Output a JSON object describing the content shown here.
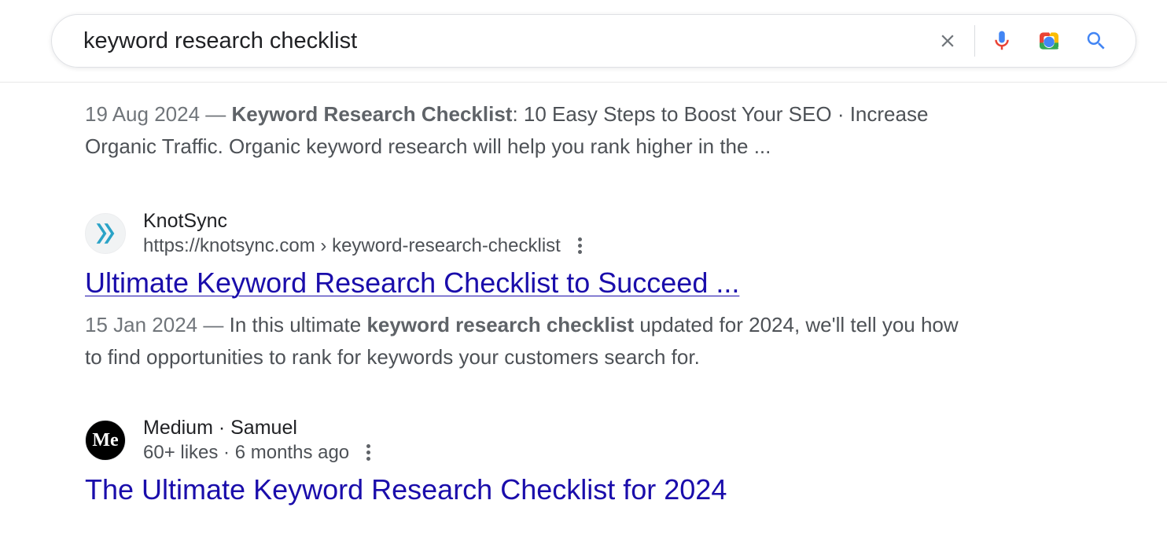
{
  "search": {
    "query": "keyword research checklist"
  },
  "partial_result": {
    "date": "19 Aug 2024",
    "bold": "Keyword Research Checklist",
    "rest": ": 10 Easy Steps to Boost Your SEO · Increase Organic Traffic. Organic keyword research will help you rank higher in the ..."
  },
  "results": [
    {
      "site_name": "KnotSync",
      "breadcrumb": "https://knotsync.com › keyword-research-checklist",
      "title": "Ultimate Keyword Research Checklist to Succeed ...",
      "date": "15 Jan 2024",
      "snippet_before": "In this ultimate ",
      "snippet_bold": "keyword research checklist",
      "snippet_after": " updated for 2024, we'll tell you how to find opportunities to rank for keywords your customers search for."
    },
    {
      "site_name": "Medium · Samuel",
      "breadcrumb": "60+ likes · 6 months ago",
      "title": "The Ultimate Keyword Research Checklist for 2024"
    }
  ]
}
